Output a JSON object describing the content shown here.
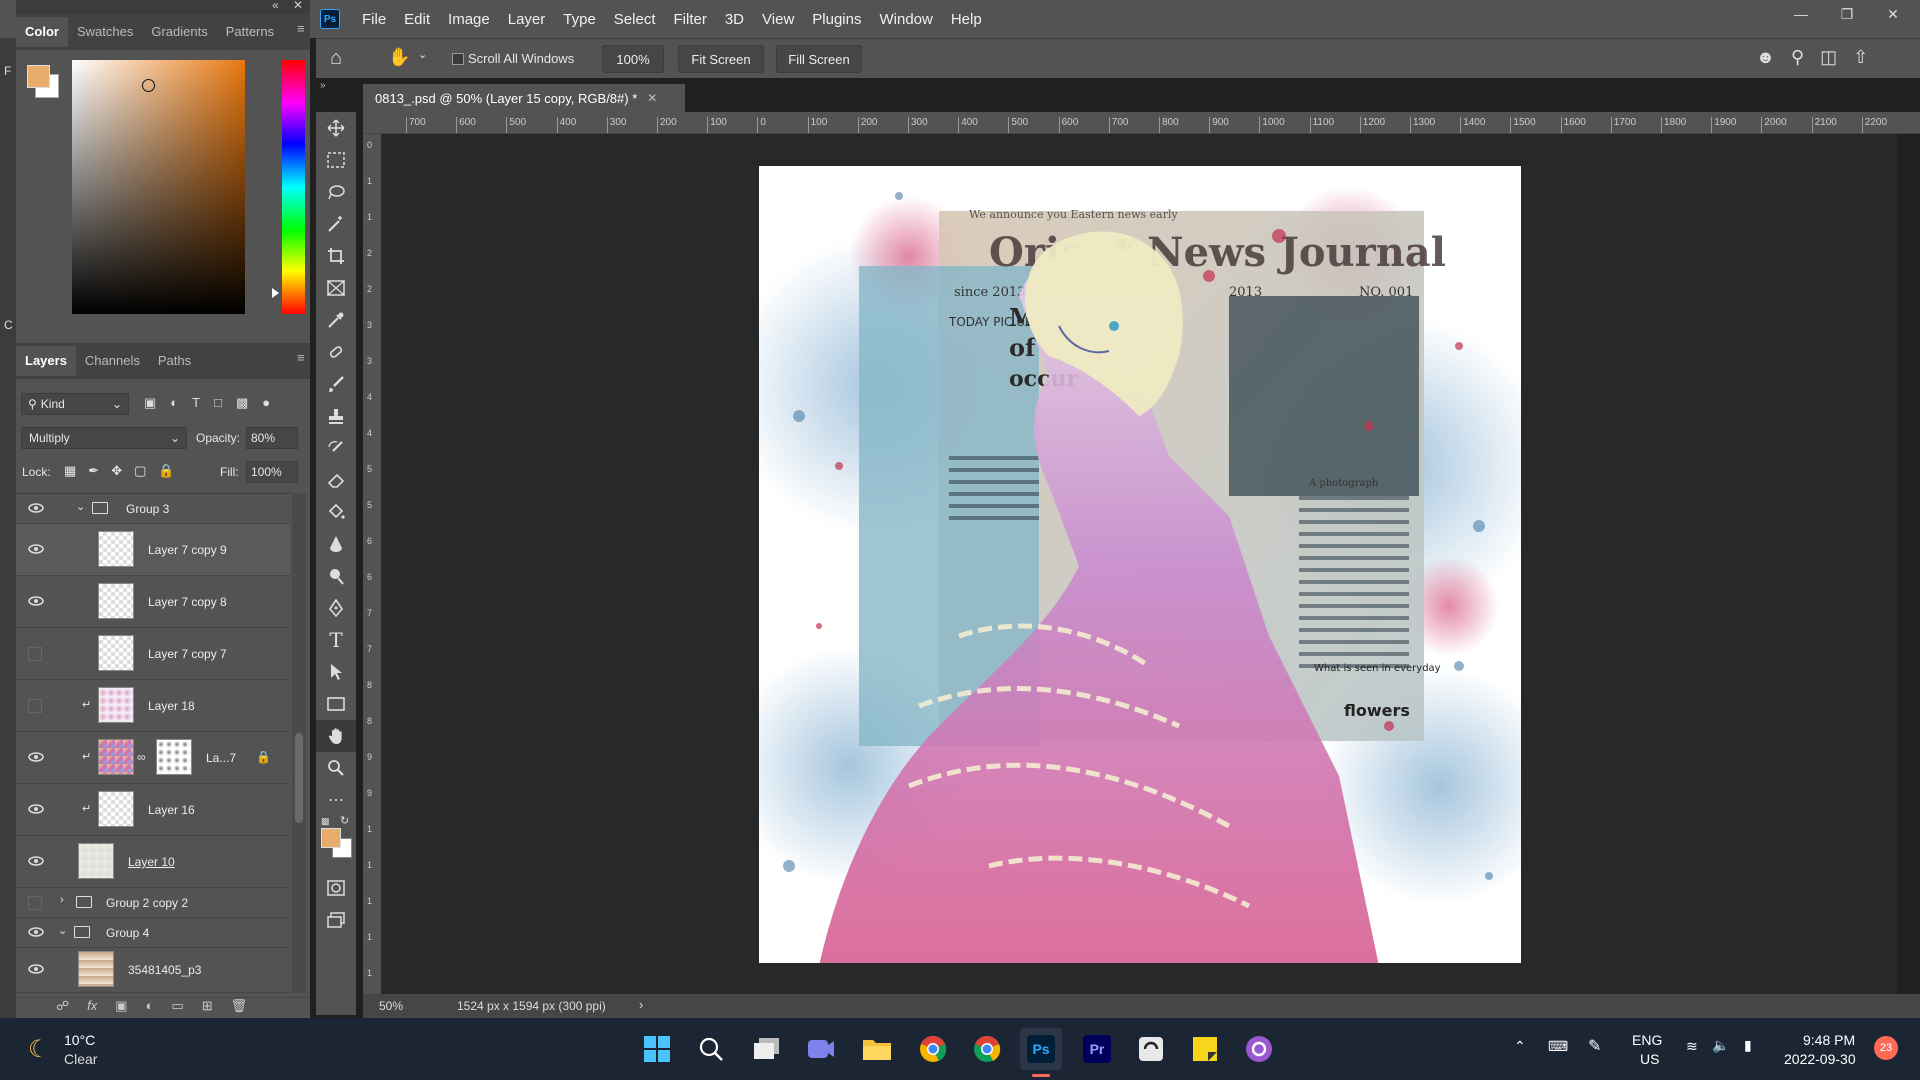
{
  "app": {
    "logo": "Ps",
    "menu": [
      "File",
      "Edit",
      "Image",
      "Layer",
      "Type",
      "Select",
      "Filter",
      "3D",
      "View",
      "Plugins",
      "Window",
      "Help"
    ]
  },
  "color_panel": {
    "tabs": [
      "Color",
      "Swatches",
      "Gradients",
      "Patterns"
    ],
    "foreground": "#e8ad6c",
    "background": "#ffffff"
  },
  "layers_panel": {
    "tabs": [
      "Layers",
      "Channels",
      "Paths"
    ],
    "filter_kind": "Kind",
    "blend_mode": "Multiply",
    "opacity_label": "Opacity:",
    "opacity": "80%",
    "lock_label": "Lock:",
    "fill_label": "Fill:",
    "fill": "100%",
    "layers": [
      {
        "name": "Group 3",
        "type": "group",
        "visible": true,
        "expanded": true
      },
      {
        "name": "Layer 7 copy 9",
        "type": "layer",
        "visible": true
      },
      {
        "name": "Layer 7 copy 8",
        "type": "layer",
        "visible": true
      },
      {
        "name": "Layer 7 copy 7",
        "type": "layer",
        "visible": false
      },
      {
        "name": "Layer 18",
        "type": "layer",
        "visible": false,
        "clipped": true
      },
      {
        "name": "La...7",
        "type": "layer",
        "visible": true,
        "clipped": true,
        "mask": true,
        "locked": true
      },
      {
        "name": "Layer 16",
        "type": "layer",
        "visible": true,
        "clipped": true
      },
      {
        "name": "Layer 10",
        "type": "layer",
        "visible": true
      },
      {
        "name": "Group 2 copy 2",
        "type": "group",
        "visible": false,
        "expanded": false
      },
      {
        "name": "Group 4",
        "type": "group",
        "visible": true,
        "expanded": true
      },
      {
        "name": "35481405_p3",
        "type": "layer",
        "visible": true
      }
    ]
  },
  "options_bar": {
    "scroll_all": "Scroll All Windows",
    "zoom": "100%",
    "fit": "Fit Screen",
    "fill": "Fill Screen"
  },
  "document": {
    "tab_title": "0813_.psd @ 50% (Layer 15 copy, RGB/8#) *",
    "zoom": "50%",
    "info": "1524 px x 1594 px (300 ppi)"
  },
  "ruler_ticks": [
    "700",
    "600",
    "500",
    "400",
    "300",
    "200",
    "100",
    "0",
    "100",
    "200",
    "300",
    "400",
    "500",
    "600",
    "700",
    "800",
    "900",
    "1000",
    "1100",
    "1200",
    "1300",
    "1400",
    "1500",
    "1600",
    "1700",
    "1800",
    "1900",
    "2000",
    "2100",
    "2200"
  ],
  "vruler_ticks": [
    "0",
    "1",
    "1",
    "2",
    "2",
    "3",
    "3",
    "4",
    "4",
    "5",
    "5",
    "6",
    "6",
    "7",
    "7",
    "8",
    "8",
    "9",
    "9",
    "1",
    "1",
    "1",
    "1",
    "1"
  ],
  "artwork": {
    "headline": "Orient News Journal",
    "banner": "We announce you Eastern news early",
    "since": "since 2013",
    "issue": "NO. 001",
    "year": "2013",
    "today": "TODAY PIC UP",
    "many": "Many",
    "of": "of",
    "occur": "occur",
    "flowers": "flowers",
    "photo_caption": "A photograph",
    "body": "What is seen in everyday"
  },
  "taskbar": {
    "temp": "10°C",
    "weather": "Clear",
    "lang1": "ENG",
    "lang2": "US",
    "time": "9:48 PM",
    "date": "2022-09-30",
    "badge": "23"
  }
}
